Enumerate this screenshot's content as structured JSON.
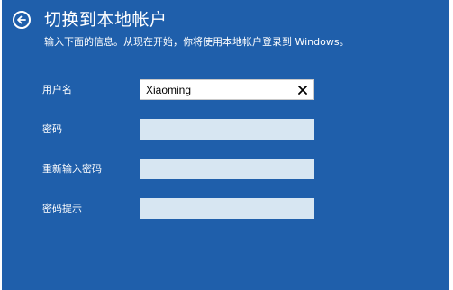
{
  "header": {
    "back_icon": "arrow-left-circle-icon",
    "title": "切换到本地帐户",
    "subtitle": "输入下面的信息。从现在开始，你将使用本地帐户登录到 Windows。"
  },
  "form": {
    "username": {
      "label": "用户名",
      "value": "Xiaoming",
      "clear_icon": "close-icon"
    },
    "password": {
      "label": "密码",
      "value": ""
    },
    "confirm_password": {
      "label": "重新输入密码",
      "value": ""
    },
    "password_hint": {
      "label": "密码提示",
      "value": ""
    }
  },
  "colors": {
    "background": "#1f5fab",
    "field_inactive": "#d7e6f2",
    "field_active": "#ffffff",
    "text": "#ffffff"
  }
}
